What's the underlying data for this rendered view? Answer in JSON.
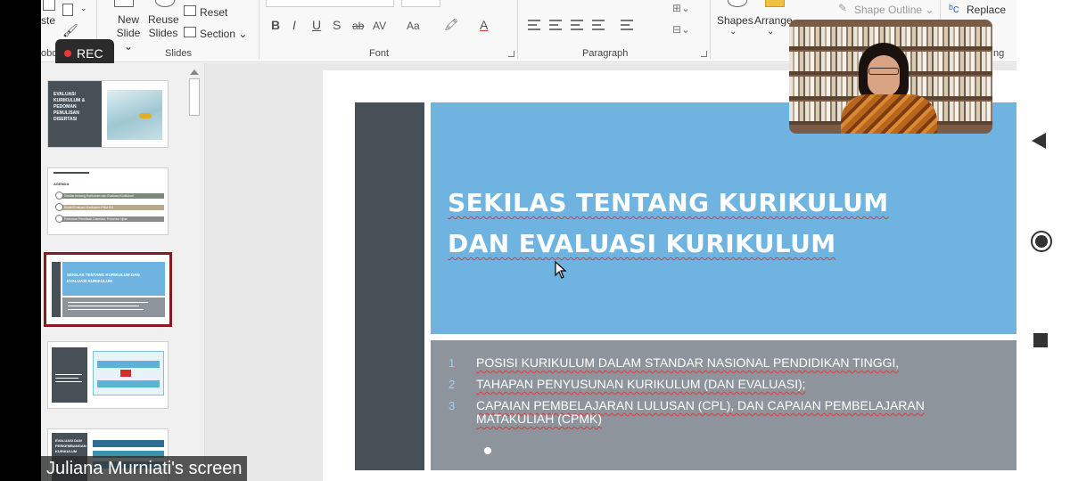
{
  "ribbon": {
    "paste_label_fragment": "ste",
    "clipboard_label_fragment": "oboa",
    "new_slide": [
      "New",
      "Slide"
    ],
    "reuse_slides": [
      "Reuse",
      "Slides"
    ],
    "reset_label": "Reset",
    "section_label": "Section",
    "slides_group_label": "Slides",
    "font_group_label": "Font",
    "paragraph_group_label": "Paragraph",
    "editing_group_fragment": "ng",
    "format_buttons": [
      "B",
      "I",
      "U",
      "S",
      "ab",
      "AV",
      "Aa"
    ],
    "shapes_label": "Shapes",
    "arrange_label": "Arrange",
    "shape_outline_label": "Shape Outline",
    "replace_label": "Replace"
  },
  "recording": {
    "label": "REC"
  },
  "thumbnails": [
    {
      "lines": [
        "EVALUASI",
        "KURIKULUM &",
        "PEDOMAN",
        "PENULISAN",
        "DISERTASI"
      ]
    },
    {
      "heading": "AGENDA",
      "items": [
        "Sekilas tentang Kurikulum dan Evaluasi Kurikulum",
        "Model Evaluasi Kurikulum PNM SI3",
        "Pedoman Penulisan Disertasi, Prosedur Ujian"
      ]
    },
    {
      "title": "SEKILAS TENTANG KURIKULUM DAN EVALUASI KURIKULUM",
      "selected": true
    },
    {},
    {
      "lines": [
        "EVALUASI DAN",
        "PERKEMBANGAN",
        "KURIKULUM"
      ]
    }
  ],
  "slide": {
    "title_lines": [
      "SEKILAS TENTANG KURIKULUM",
      "DAN EVALUASI KURIKULUM"
    ],
    "list": [
      {
        "num": "1",
        "text": "POSISI KURIKULUM DALAM STANDAR NASIONAL PENDIDIKAN TINGGI,"
      },
      {
        "num": "2",
        "text": "TAHAPAN PENYUSUNAN KURIKULUM (DAN EVALUASI);"
      },
      {
        "num": "3",
        "text": "CAPAIAN PEMBELAJARAN LULUSAN (CPL), DAN CAPAIAN PEMBELAJARAN MATAKULIAH (CPMK)"
      }
    ]
  },
  "caption": {
    "text": "Juliana Murniati's screen"
  },
  "colors": {
    "slide_blue": "#6fb3e0",
    "slide_dark": "#474f57",
    "slide_grey": "#8d949b",
    "selection_border": "#8b1a1a",
    "spell_underline": "#d23c3c"
  }
}
